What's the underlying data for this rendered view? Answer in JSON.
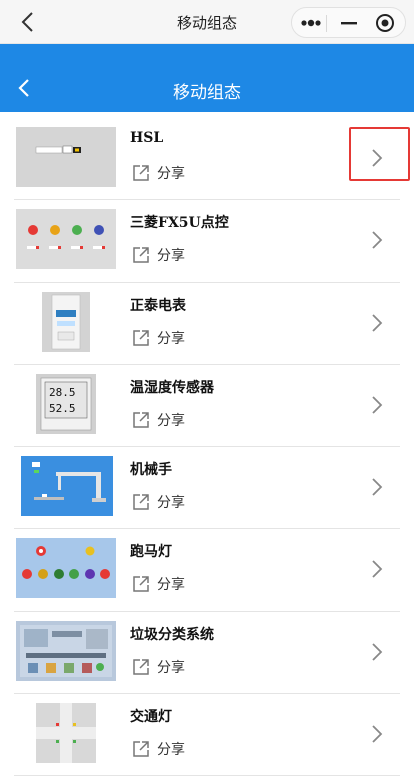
{
  "wechat_nav": {
    "title": "移动组态"
  },
  "header": {
    "title": "移动组态"
  },
  "items": [
    {
      "name": "HSL",
      "share_label": "分享",
      "thumb": "hsl"
    },
    {
      "name": "三菱FX5U点控",
      "share_label": "分享",
      "thumb": "lights-row"
    },
    {
      "name": "正泰电表",
      "share_label": "分享",
      "thumb": "meter"
    },
    {
      "name": "温湿度传感器",
      "share_label": "分享",
      "thumb": "thermo",
      "thumb_text": [
        "28.5",
        "52.5"
      ]
    },
    {
      "name": "机械手",
      "share_label": "分享",
      "thumb": "robot"
    },
    {
      "name": "跑马灯",
      "share_label": "分享",
      "thumb": "marquee"
    },
    {
      "name": "垃圾分类系统",
      "share_label": "分享",
      "thumb": "garbage"
    },
    {
      "name": "交通灯",
      "share_label": "分享",
      "thumb": "traffic"
    }
  ],
  "colors": {
    "header_blue": "#1e88e5",
    "highlight_red": "#e53935"
  }
}
